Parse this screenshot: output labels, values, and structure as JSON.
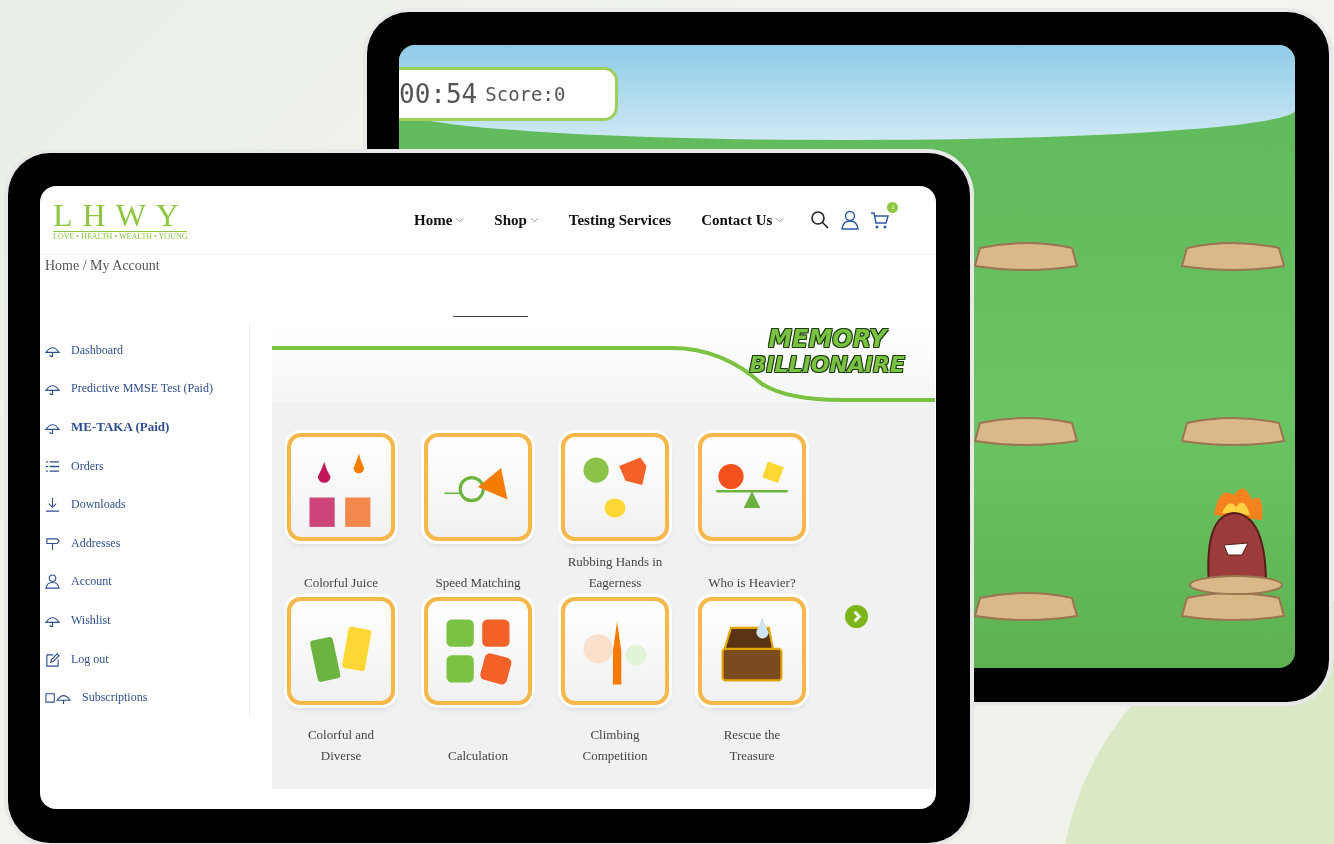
{
  "game": {
    "timer": "00:54",
    "score": "Score:0"
  },
  "site": {
    "logo": "LHWY",
    "tagline": "LOVE • HEALTH • WEALTH • YOUNG",
    "nav": [
      {
        "label": "Home",
        "dropdown": true
      },
      {
        "label": "Shop",
        "dropdown": true
      },
      {
        "label": "Testing Services",
        "dropdown": false
      },
      {
        "label": "Contact Us",
        "dropdown": true
      }
    ],
    "cart_count": "1",
    "breadcrumb": "Home / My Account",
    "sidebar": [
      {
        "label": "Dashboard",
        "kind": "umbrella",
        "selected": false
      },
      {
        "label": "Predictive MMSE Test (Paid)",
        "kind": "umbrella",
        "selected": false
      },
      {
        "label": "ME-TAKA (Paid)",
        "kind": "umbrella",
        "selected": true
      },
      {
        "label": "Orders",
        "kind": "list",
        "selected": false
      },
      {
        "label": "Downloads",
        "kind": "download",
        "selected": false
      },
      {
        "label": "Addresses",
        "kind": "signpost",
        "selected": false
      },
      {
        "label": "Account",
        "kind": "user",
        "selected": false
      },
      {
        "label": "Wishlist",
        "kind": "umbrella",
        "selected": false
      },
      {
        "label": "Log out",
        "kind": "edit",
        "selected": false
      },
      {
        "label": "Subscriptions",
        "kind": "subscriptions",
        "selected": false
      }
    ],
    "banner": {
      "line1": "MEMORY",
      "line2": "BILLIONAIRE"
    },
    "games": [
      {
        "label": "Colorful Juice",
        "kind": "juice"
      },
      {
        "label": "Speed Matching",
        "kind": "cone"
      },
      {
        "label": "Rubbing Hands in Eagerness",
        "kind": "hands"
      },
      {
        "label": "Who is Heavier?",
        "kind": "balance"
      },
      {
        "label": "Colorful and Diverse",
        "kind": "tubes"
      },
      {
        "label": "Calculation",
        "kind": "math"
      },
      {
        "label": "Climbing Competition",
        "kind": "tower"
      },
      {
        "label": "Rescue the Treasure",
        "kind": "chest"
      }
    ]
  }
}
